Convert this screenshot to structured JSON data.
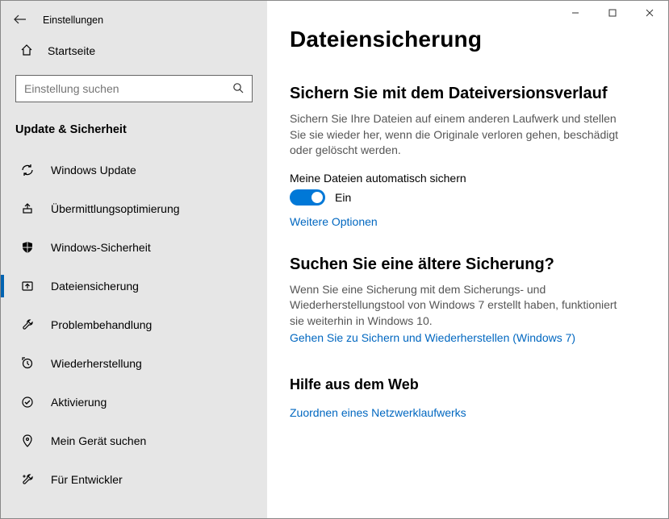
{
  "window": {
    "title": "Einstellungen"
  },
  "sidebar": {
    "home_label": "Startseite",
    "search_placeholder": "Einstellung suchen",
    "category": "Update & Sicherheit",
    "items": [
      {
        "label": "Windows Update"
      },
      {
        "label": "Übermittlungsoptimierung"
      },
      {
        "label": "Windows-Sicherheit"
      },
      {
        "label": "Dateiensicherung"
      },
      {
        "label": "Problembehandlung"
      },
      {
        "label": "Wiederherstellung"
      },
      {
        "label": "Aktivierung"
      },
      {
        "label": "Mein Gerät suchen"
      },
      {
        "label": "Für Entwickler"
      }
    ]
  },
  "content": {
    "page_title": "Dateiensicherung",
    "section1": {
      "heading": "Sichern Sie mit dem Dateiversionsverlauf",
      "desc": "Sichern Sie Ihre Dateien auf einem anderen Laufwerk und stellen Sie sie wieder her, wenn die Originale verloren gehen, beschädigt oder gelöscht werden.",
      "toggle_label": "Meine Dateien automatisch sichern",
      "toggle_state": "Ein",
      "toggle_on": true,
      "more_options": "Weitere Optionen"
    },
    "section2": {
      "heading": "Suchen Sie eine ältere Sicherung?",
      "desc": "Wenn Sie eine Sicherung mit dem Sicherungs- und Wiederherstellungstool von Windows 7 erstellt haben, funktioniert sie weiterhin in Windows 10.",
      "link": "Gehen Sie zu Sichern und Wiederherstellen (Windows 7)"
    },
    "help": {
      "heading": "Hilfe aus dem Web",
      "link": "Zuordnen eines Netzwerklaufwerks"
    }
  }
}
